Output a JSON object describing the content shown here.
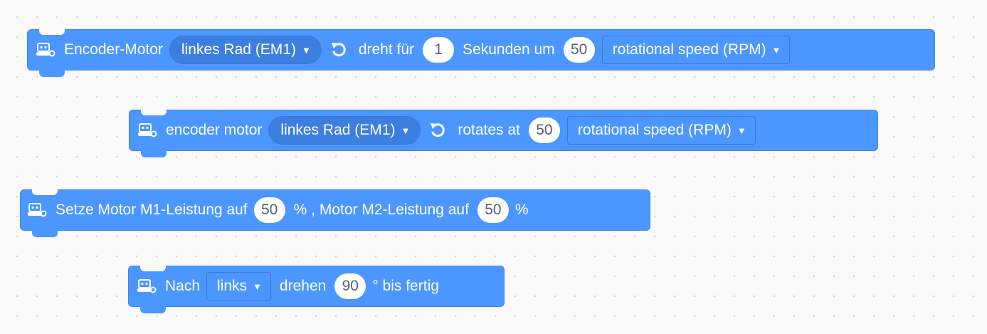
{
  "blocks": [
    {
      "icon": "robot-icon",
      "label": "Encoder-Motor",
      "motor_dropdown": "linkes Rad (EM1)",
      "direction_icon": "rotate-ccw-icon",
      "text1": "dreht für",
      "duration": "1",
      "text2": "Sekunden um",
      "speed": "50",
      "unit_dropdown": "rotational speed (RPM)"
    },
    {
      "icon": "robot-icon",
      "label": "encoder motor",
      "motor_dropdown": "linkes Rad (EM1)",
      "direction_icon": "rotate-ccw-icon",
      "text1": "rotates at",
      "speed": "50",
      "unit_dropdown": "rotational speed (RPM)"
    },
    {
      "icon": "robot-icon",
      "label": "Setze Motor M1-Leistung auf",
      "m1_power": "50",
      "text1": "% , Motor M2-Leistung auf",
      "m2_power": "50",
      "text2": "%"
    },
    {
      "icon": "robot-icon",
      "label": "Nach",
      "direction_dropdown": "links",
      "text1": "drehen",
      "angle": "90",
      "text2": "° bis fertig"
    }
  ],
  "colors": {
    "block": "#4c97ff",
    "block_border": "#3f85e6",
    "dropdown_dark": "#3d7fe0",
    "number_text": "#575e75",
    "background": "#f9f9f9"
  }
}
